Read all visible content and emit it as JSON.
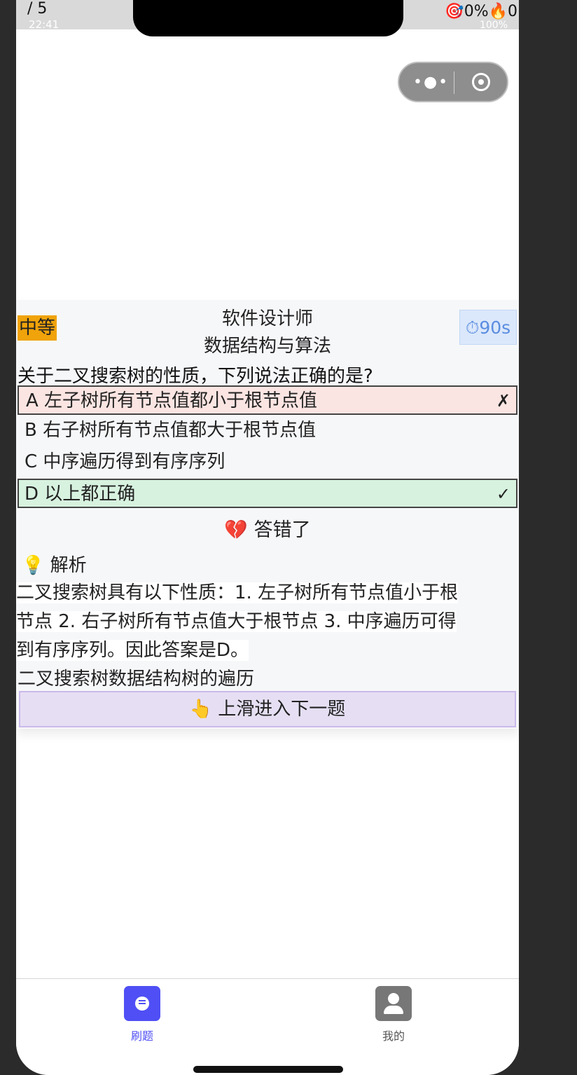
{
  "status": {
    "counter": "/ 5",
    "time": "22:41",
    "right_text": "🎯0%🔥0",
    "battery": "100%"
  },
  "question_card": {
    "difficulty": "中等",
    "exam": "软件设计师",
    "subject": "数据结构与算法",
    "timer": "⏱90s",
    "question": "关于二叉搜索树的性质，下列说法正确的是?",
    "options": [
      {
        "label": "A 左子树所有节点值都小于根节点值",
        "mark": "✗"
      },
      {
        "label": "B 右子树所有节点值都大于根节点值",
        "mark": ""
      },
      {
        "label": "C 中序遍历得到有序序列",
        "mark": ""
      },
      {
        "label": "D 以上都正确",
        "mark": "✓"
      }
    ],
    "result": "💔 答错了",
    "analysis_heading": "💡 解析",
    "analysis_lines": [
      "二叉搜索树具有以下性质：1. 左子树所有节点值小于根",
      "节点 2. 右子树所有节点值大于根节点 3. 中序遍历可得",
      "到有序序列。因此答案是D。"
    ],
    "tags": "二叉搜索树数据结构树的遍历",
    "next_hint": "👆 上滑进入下一题"
  },
  "tabbar": {
    "tabs": [
      {
        "label": "刷题",
        "icon": "study-icon",
        "active": true
      },
      {
        "label": "我的",
        "icon": "user-icon",
        "active": false
      }
    ]
  },
  "colors": {
    "difficulty_bg": "#f0a30a",
    "wrong_bg": "#fbe5e2",
    "correct_bg": "#d7f2df",
    "accent": "#4f4ff5",
    "next_bg": "#e6dff3"
  }
}
